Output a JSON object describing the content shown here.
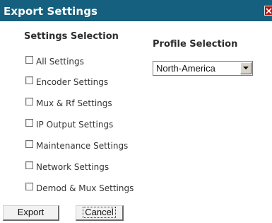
{
  "dialog": {
    "title": "Export Settings",
    "colors": {
      "titlebar": "#15607f",
      "close_button": "#b5150f"
    }
  },
  "settings_selection": {
    "heading": "Settings Selection",
    "options": [
      {
        "label": "All Settings",
        "checked": false
      },
      {
        "label": "Encoder Settings",
        "checked": false
      },
      {
        "label": "Mux & Rf Settings",
        "checked": false
      },
      {
        "label": "IP Output Settings",
        "checked": false
      },
      {
        "label": "Maintenance Settings",
        "checked": false
      },
      {
        "label": "Network Settings",
        "checked": false
      },
      {
        "label": "Demod & Mux Settings",
        "checked": false
      }
    ]
  },
  "profile_selection": {
    "heading": "Profile Selection",
    "selected": "North-America"
  },
  "buttons": {
    "export": "Export",
    "cancel": "Cancel"
  },
  "icons": {
    "close": "close-icon",
    "dropdown": "chevron-down-icon"
  }
}
